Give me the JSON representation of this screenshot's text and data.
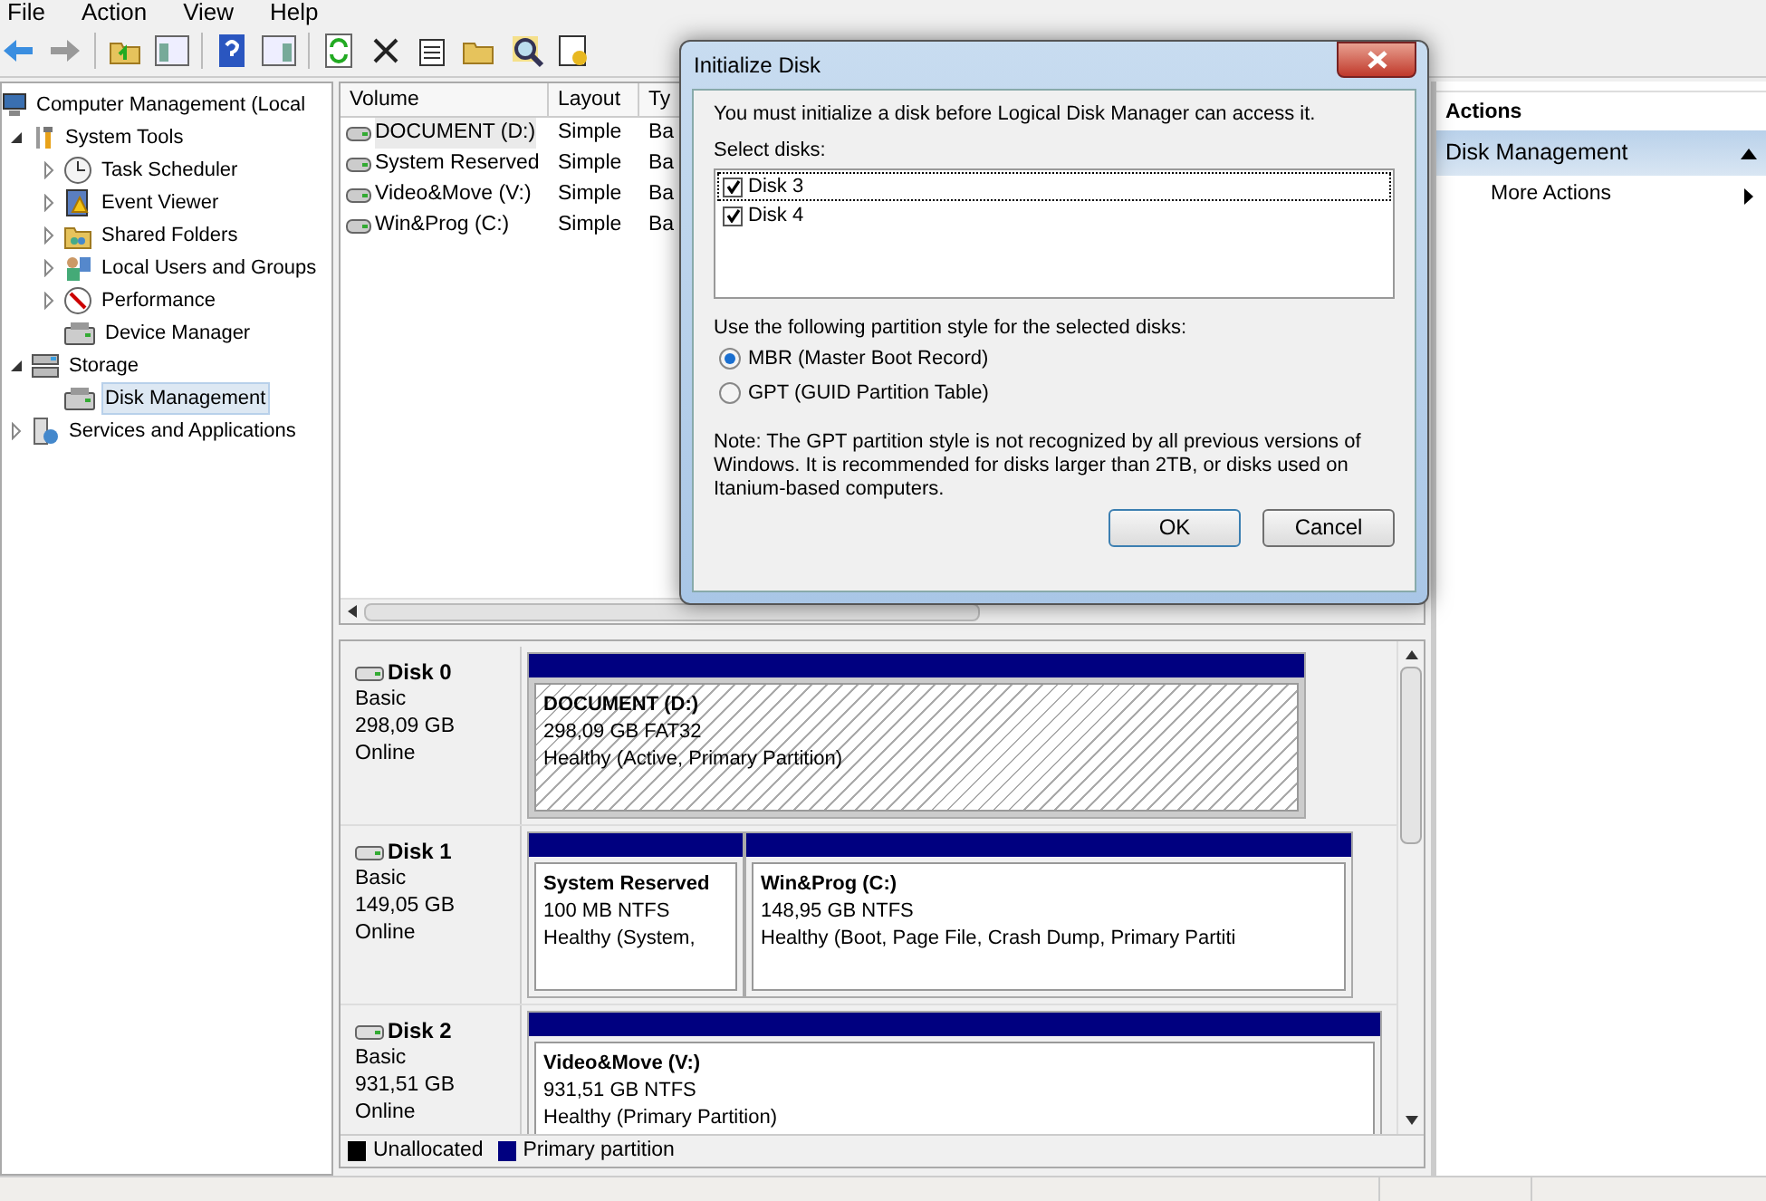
{
  "menu": [
    "File",
    "Action",
    "View",
    "Help"
  ],
  "tree": [
    {
      "label": "Computer Management (Local",
      "selected": false,
      "children": [
        {
          "label": "System Tools",
          "expanded": true,
          "selected": false,
          "children": [
            {
              "label": "Task Scheduler",
              "expanded": false,
              "selected": false
            },
            {
              "label": "Event Viewer",
              "expanded": false,
              "selected": false
            },
            {
              "label": "Shared Folders",
              "expanded": false,
              "selected": false
            },
            {
              "label": "Local Users and Groups",
              "expanded": false,
              "selected": false
            },
            {
              "label": "Performance",
              "expanded": false,
              "selected": false
            },
            {
              "label": "Device Manager",
              "selected": false
            }
          ]
        },
        {
          "label": "Storage",
          "expanded": true,
          "selected": false,
          "children": [
            {
              "label": "Disk Management",
              "selected": true
            }
          ]
        },
        {
          "label": "Services and Applications",
          "expanded": false,
          "selected": false
        }
      ]
    }
  ],
  "volume_table": {
    "columns": [
      "Volume",
      "Layout",
      "Ty"
    ],
    "rows": [
      {
        "cells": [
          "DOCUMENT (D:)",
          "Simple",
          "Ba"
        ],
        "selected": true
      },
      {
        "cells": [
          "System Reserved",
          "Simple",
          "Ba"
        ],
        "selected": false
      },
      {
        "cells": [
          "Video&Move (V:)",
          "Simple",
          "Ba"
        ],
        "selected": false
      },
      {
        "cells": [
          "Win&Prog (C:)",
          "Simple",
          "Ba"
        ],
        "selected": false
      }
    ]
  },
  "disks": [
    {
      "name": "Disk 0",
      "type": "Basic",
      "size": "298,09 GB",
      "status": "Online",
      "partitions": [
        {
          "name": "DOCUMENT  (D:)",
          "size": "298,09 GB FAT32",
          "status": "Healthy (Active, Primary Partition)",
          "selected": true
        }
      ]
    },
    {
      "name": "Disk 1",
      "type": "Basic",
      "size": "149,05 GB",
      "status": "Online",
      "partitions": [
        {
          "name": "System Reserved",
          "size": "100 MB NTFS",
          "status": "Healthy (System,",
          "selected": false
        },
        {
          "name": "Win&Prog  (C:)",
          "size": "148,95 GB NTFS",
          "status": "Healthy (Boot, Page File, Crash Dump, Primary Partiti",
          "selected": false
        }
      ]
    },
    {
      "name": "Disk 2",
      "type": "Basic",
      "size": "931,51 GB",
      "status": "Online",
      "partitions": [
        {
          "name": "Video&Move  (V:)",
          "size": "931,51 GB NTFS",
          "status": "Healthy (Primary Partition)",
          "selected": false
        }
      ]
    }
  ],
  "legend": [
    {
      "label": "Unallocated",
      "color": "#000000"
    },
    {
      "label": "Primary partition",
      "color": "#000080"
    }
  ],
  "actions": {
    "title": "Actions",
    "section": "Disk Management",
    "items": [
      "More Actions"
    ]
  },
  "dialog": {
    "title": "Initialize Disk",
    "message": "You must initialize a disk before Logical Disk Manager can access it.",
    "select_label": "Select disks:",
    "disks": [
      {
        "label": "Disk 3",
        "checked": true
      },
      {
        "label": "Disk 4",
        "checked": true
      }
    ],
    "style_label": "Use the following partition style for the selected disks:",
    "styles": [
      {
        "label": "MBR (Master Boot Record)",
        "selected": true
      },
      {
        "label": "GPT (GUID Partition Table)",
        "selected": false
      }
    ],
    "note": "Note: The GPT partition style is not recognized by all previous versions of Windows. It is recommended for disks larger than 2TB, or disks used on Itanium-based computers.",
    "buttons": [
      "OK",
      "Cancel"
    ]
  }
}
